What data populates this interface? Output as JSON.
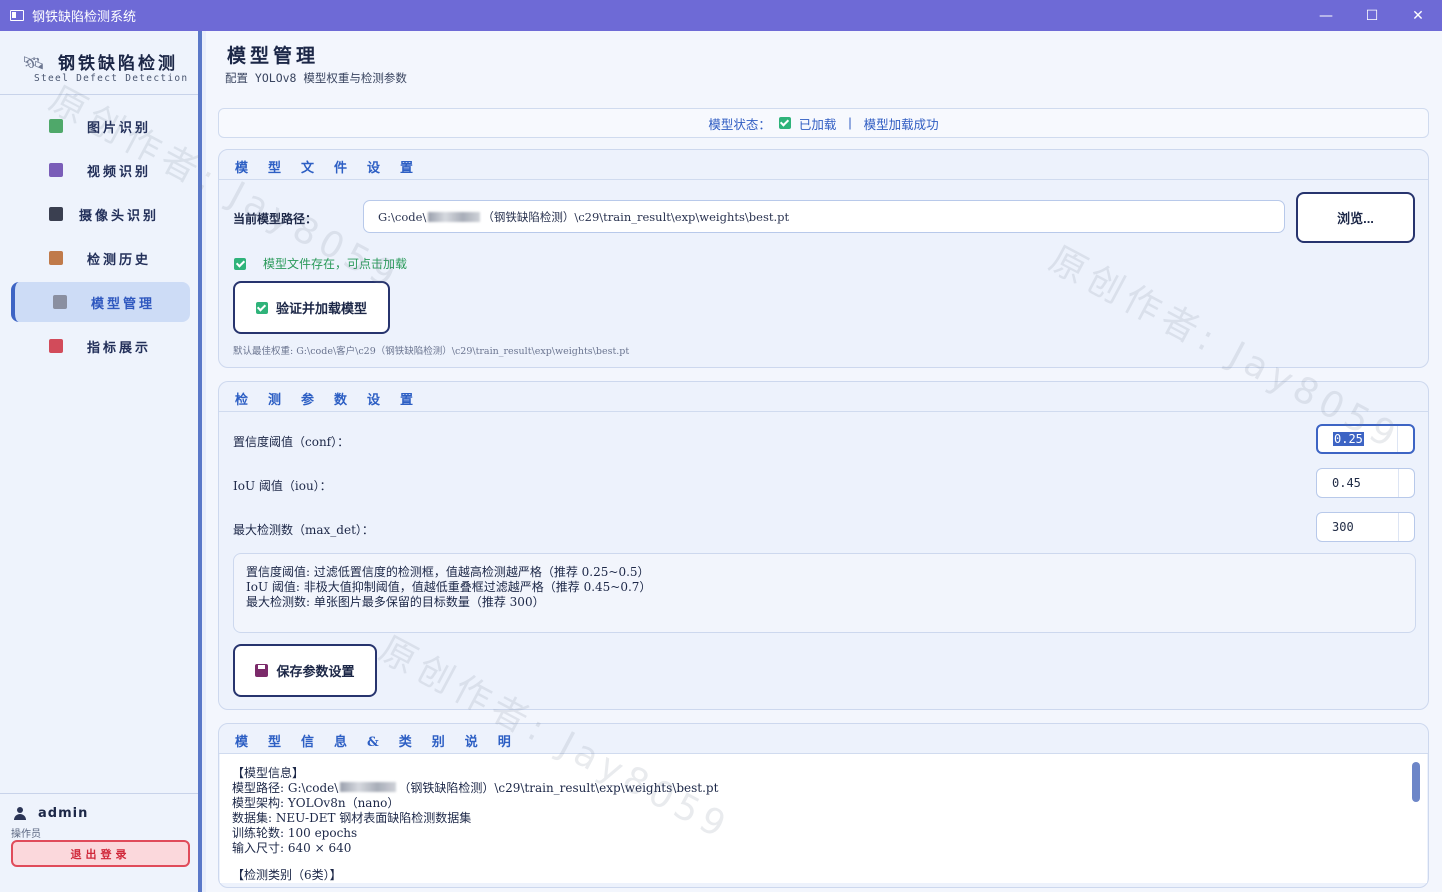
{
  "window": {
    "title": "钢铁缺陷检测系统",
    "minimize": "—",
    "maximize": "☐",
    "close": "✕"
  },
  "sidebar": {
    "brand_name": "钢铁缺陷检测",
    "brand_sub": "Steel Defect Detection",
    "items": [
      {
        "label": "图片识别",
        "icon": "image-icon",
        "color": "#4fa86a"
      },
      {
        "label": "视频识别",
        "icon": "film-icon",
        "color": "#7a5db8"
      },
      {
        "label": "摄像头识别",
        "icon": "camera-icon",
        "color": "#3a3f50"
      },
      {
        "label": "检测历史",
        "icon": "clipboard-icon",
        "color": "#c07a4a"
      },
      {
        "label": "模型管理",
        "icon": "gear-icon",
        "color": "#8a8fa0"
      },
      {
        "label": "指标展示",
        "icon": "bar-chart-icon",
        "color": "#d24b5a"
      }
    ],
    "active_index": 4,
    "user": {
      "name": "admin",
      "role": "操作员",
      "logout": "退出登录"
    }
  },
  "header": {
    "title": "模型管理",
    "subtitle": "配置 YOLOv8 模型权重与检测参数"
  },
  "status": {
    "label": "模型状态：",
    "loaded": "已加载",
    "separator": "|",
    "message": "模型加载成功"
  },
  "model_file": {
    "section_title": "模型文件设置",
    "path_label": "当前模型路径：",
    "path_prefix": "G:\\code\\",
    "path_suffix": "（钢铁缺陷检测）\\c29\\train_result\\exp\\weights\\best.pt",
    "browse": "浏览...",
    "exists_msg": "模型文件存在，可点击加载",
    "verify_button": "验证并加载模型",
    "default_weights": "默认最佳权重: G:\\code\\客户\\c29（钢铁缺陷检测）\\c29\\train_result\\exp\\weights\\best.pt"
  },
  "params": {
    "section_title": "检测参数设置",
    "conf_label": "置信度阈值（conf）：",
    "conf_value": "0.25",
    "iou_label": "IoU 阈值（iou）：",
    "iou_value": "0.45",
    "maxdet_label": "最大检测数（max_det）：",
    "maxdet_value": "300",
    "help_lines": [
      "置信度阈值: 过滤低置信度的检测框，值越高检测越严格（推荐 0.25~0.5）",
      "IoU 阈值: 非极大值抑制阈值，值越低重叠框过滤越严格（推荐 0.45~0.7）",
      "最大检测数: 单张图片最多保留的目标数量（推荐 300）"
    ],
    "save_button": "保存参数设置"
  },
  "info": {
    "section_title": "模型信息&类别说明",
    "heading": "【模型信息】",
    "path_prefix": "模型路径: G:\\code\\",
    "path_suffix": "（钢铁缺陷检测）\\c29\\train_result\\exp\\weights\\best.pt",
    "lines": [
      "模型架构: YOLOv8n（nano）",
      "数据集: NEU-DET 钢材表面缺陷检测数据集",
      "训练轮数: 100 epochs",
      "输入尺寸: 640 × 640"
    ],
    "cut_line": "【检测类别（6类）】"
  },
  "watermark": "原创作者: Jay8059"
}
